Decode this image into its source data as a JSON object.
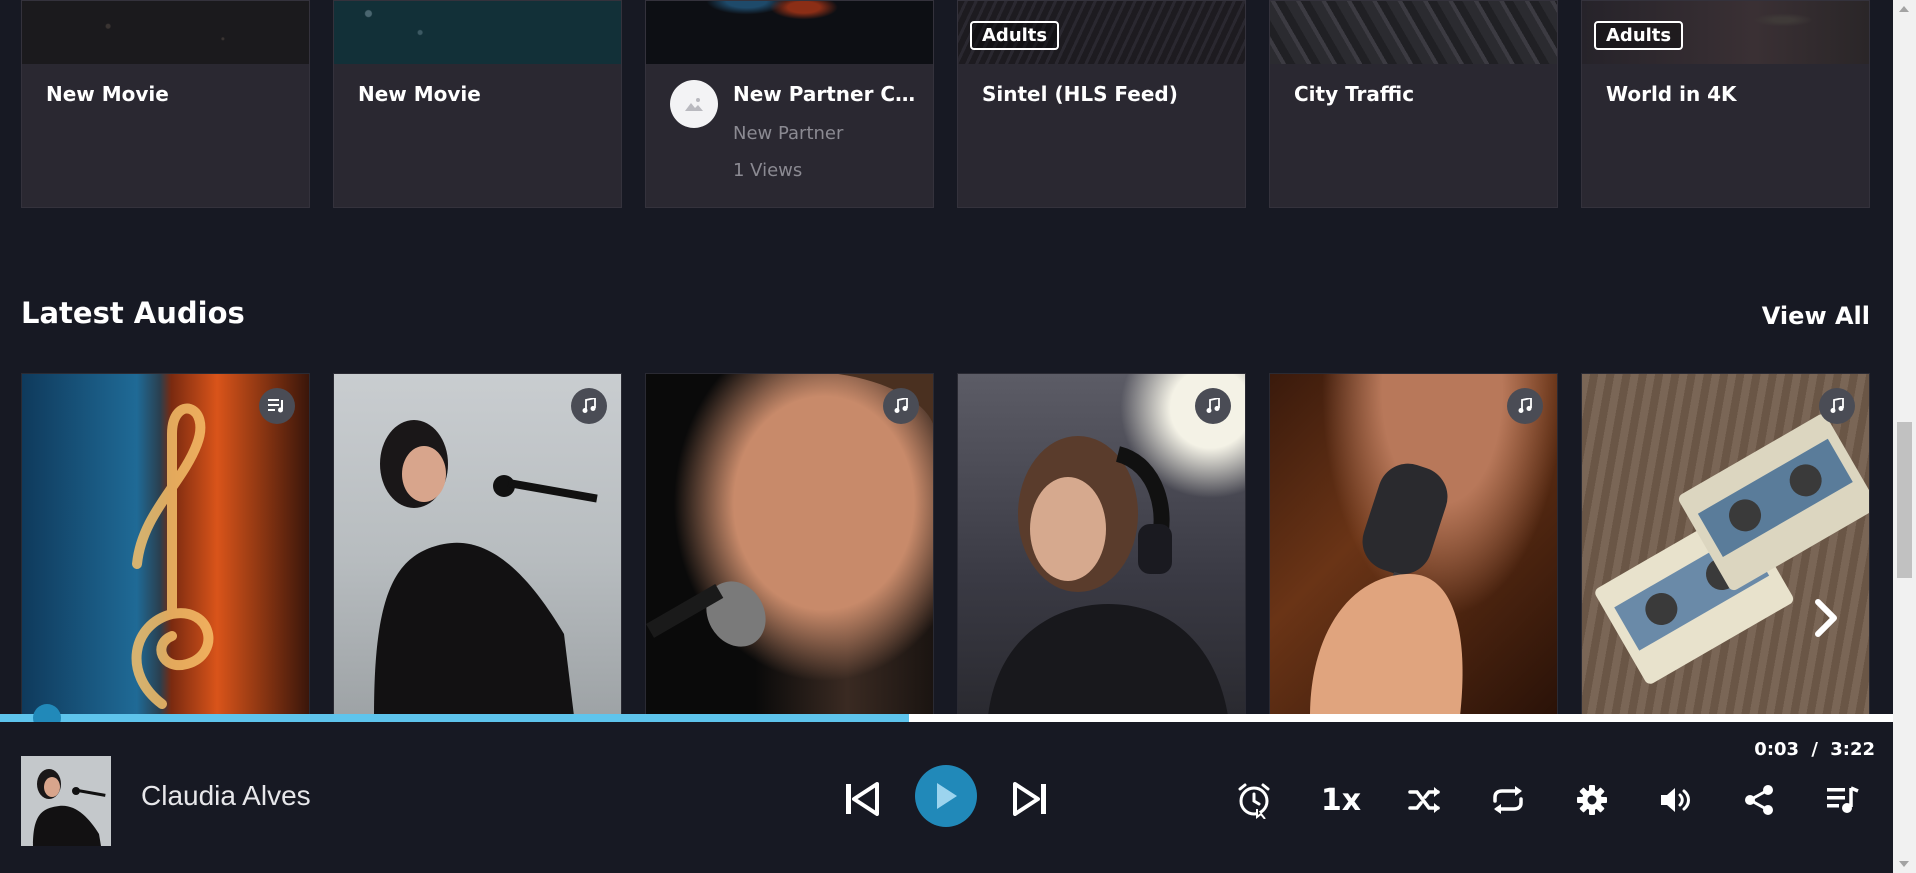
{
  "video_cards": [
    {
      "title": "New Movie"
    },
    {
      "title": "New Movie"
    },
    {
      "title": "New Partner Co...",
      "partner": "New Partner",
      "views": "1 Views"
    },
    {
      "title": "Sintel (HLS Feed)",
      "badge": "Adults"
    },
    {
      "title": "City Traffic"
    },
    {
      "title": "World in 4K",
      "badge": "Adults"
    }
  ],
  "section": {
    "title": "Latest Audios",
    "view_all": "View All"
  },
  "audio_cards": [
    {
      "name": "treble-clef-fire-water",
      "type_icon": "playlist-icon"
    },
    {
      "name": "woman-singing-microphone",
      "type_icon": "music-note-icon"
    },
    {
      "name": "man-singing-microphone",
      "type_icon": "music-note-icon"
    },
    {
      "name": "woman-headphones-singing",
      "type_icon": "music-note-icon"
    },
    {
      "name": "man-holding-microphone",
      "type_icon": "music-note-icon"
    },
    {
      "name": "cassette-tapes",
      "type_icon": "music-note-icon"
    }
  ],
  "player": {
    "track_title": "Claudia Alves",
    "current_time": "0:03",
    "separator": "/",
    "duration": "3:22",
    "speed": "1x",
    "progress_fraction": 0.015,
    "buffered_fraction": 0.48,
    "colors": {
      "accent": "#2189b9",
      "buffer": "#5ec4ec"
    }
  }
}
